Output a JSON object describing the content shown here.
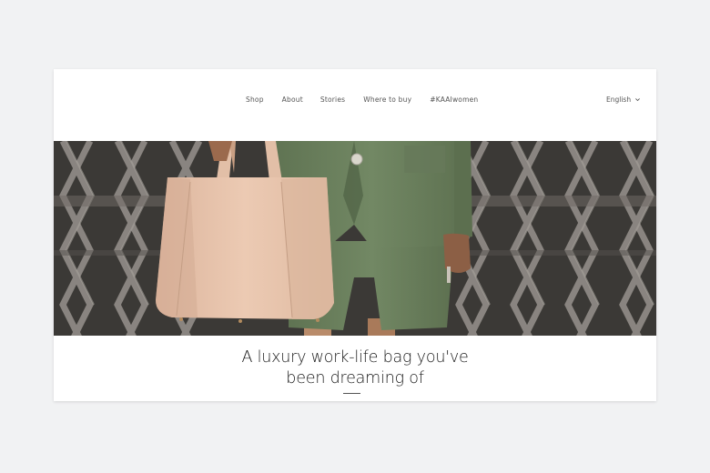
{
  "nav": {
    "items": [
      {
        "label": "Shop"
      },
      {
        "label": "About"
      },
      {
        "label": "Stories"
      },
      {
        "label": "Where to buy"
      },
      {
        "label": "#KAAIwomen"
      }
    ],
    "language": "English"
  },
  "hero": {
    "headline_line1": "A luxury work-life bag you've",
    "headline_line2": "been dreaming of"
  },
  "colors": {
    "background": "#f1f2f3",
    "panel": "#ffffff",
    "text": "#1c1c1c",
    "nav_text": "#555555",
    "bag": "#e6c3ab",
    "suit": "#6c7f5e"
  },
  "icons": {
    "language_toggle": "chevron-down-icon"
  }
}
